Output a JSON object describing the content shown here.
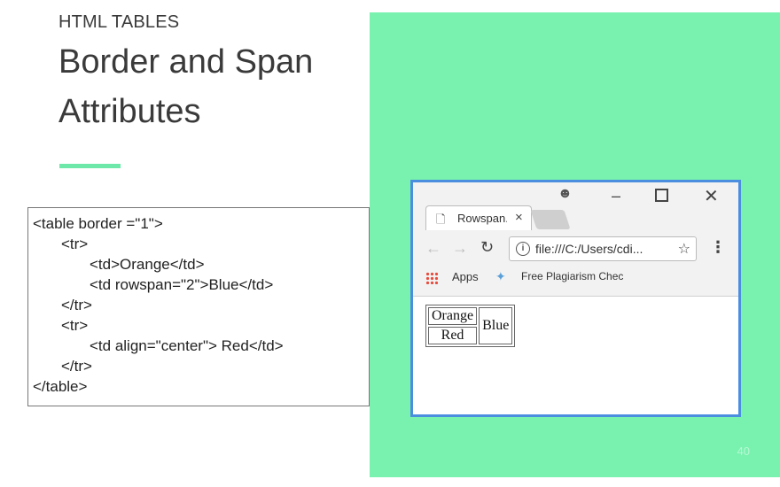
{
  "slide": {
    "kicker": "HTML TABLES",
    "title_lines": [
      "Border and Span",
      "Attributes"
    ],
    "page_number": "40",
    "accent_color": "#6ee8a8",
    "panel_color": "#78f2ae"
  },
  "code": {
    "lines": [
      "<table border =\"1\">",
      "<tr>",
      "<td>Orange</td>",
      "<td rowspan=\"2\">Blue</td>",
      "</tr>",
      "<tr>",
      "<td align=\"center\"> Red</td>",
      "</tr>",
      "</table>"
    ]
  },
  "browser": {
    "tab_title": "Rowspan.",
    "tab_close": "×",
    "url": "file:///C:/Users/cdi...",
    "bookmarks": {
      "apps_label": "Apps",
      "item_label": "Free Plagiarism Chec"
    },
    "icons": {
      "document": "document-icon",
      "profile": "profile-icon",
      "minimize": "minimize-icon",
      "maximize": "maximize-icon",
      "close": "close-icon",
      "back": "back-arrow-icon",
      "forward": "forward-arrow-icon",
      "reload": "reload-icon",
      "info": "info-icon",
      "star": "star-icon",
      "menu": "menu-icon"
    },
    "rendered_table": {
      "cell_orange": "Orange",
      "cell_blue": "Blue",
      "cell_red": "Red"
    }
  }
}
